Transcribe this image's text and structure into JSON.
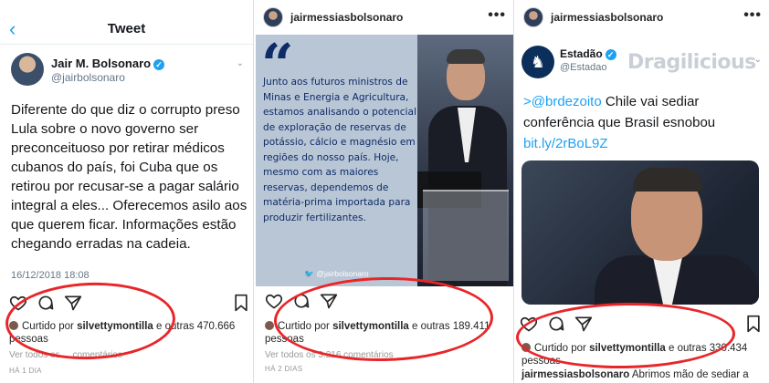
{
  "panel1": {
    "back_glyph": "‹",
    "header_title": "Tweet",
    "author_name": "Jair M. Bolsonaro",
    "author_handle": "@jairbolsonaro",
    "verified_glyph": "✓",
    "chevron_glyph": "⌄",
    "tweet_text": "Diferente do que diz o corrupto preso Lula sobre o novo governo ser preconceituoso por retirar médicos cubanos do país, foi Cuba que os retirou por recusar-se a pagar salário integral a eles... Oferecemos asilo aos que querem ficar. Informações estão chegando erradas na cadeia.",
    "date": "16/12/2018 18:08",
    "liked_prefix": "Curtido por",
    "liked_user": "silvettymontilla",
    "liked_suffix": "e outras 470.666",
    "liked_suffix2": "pessoas",
    "comments": "Ver todos os ... comentários",
    "age": "HÁ 1 DIA"
  },
  "panel2": {
    "username": "jairmessiasbolsonaro",
    "dots": "•••",
    "quote_mark": "“",
    "quote_text": "Junto aos futuros ministros de Minas e Energia e Agricultura, estamos analisando o potencial de exploração de reservas de potássio, cálcio e magnésio em regiões do nosso país. Hoje, mesmo com as maiores reservas, dependemos de matéria-prima importada para produzir fertilizantes.",
    "quote_handle": "🐦 @jairbolsonaro",
    "liked_prefix": "Curtido por",
    "liked_user": "silvettymontilla",
    "liked_suffix": "e outras 189.411",
    "liked_suffix2": "pessoas",
    "comments": "Ver todos os 3.216 comentários",
    "age": "HÁ 2 DIAS"
  },
  "panel3": {
    "username": "jairmessiasbolsonaro",
    "dots": "•••",
    "source_name": "Estadão",
    "source_handle": "@Estadao",
    "logo_glyph": "♞",
    "watermark": "Dragilicious",
    "chevron_glyph": "⌄",
    "text_mention": ">@brdezoito",
    "text_body": " Chile vai sediar conferência que Brasil esnobou ",
    "text_link": "bit.ly/2rBoL9Z",
    "liked_prefix": "Curtido por",
    "liked_user": "silvettymontilla",
    "liked_suffix": "e outras 330.434",
    "liked_suffix2": "pessoas",
    "footer_user": "jairmessiasbolsonaro",
    "footer_caption": "Abrimos mão de sediar a"
  },
  "colors": {
    "twitter_blue": "#1da1f2",
    "quote_navy": "#0d2b66",
    "annotation_red": "#e8262a"
  }
}
